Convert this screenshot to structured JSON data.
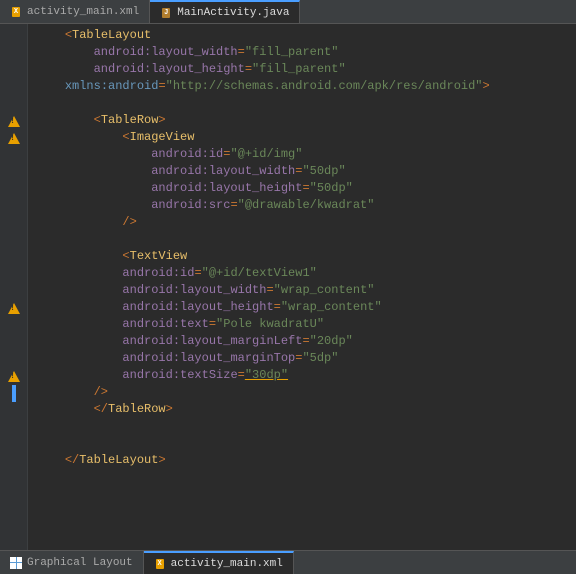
{
  "tabs": [
    {
      "id": "activity_main_xml",
      "label": "activity_main.xml",
      "type": "xml",
      "active": false
    },
    {
      "id": "mainactivity_java",
      "label": "MainActivity.java",
      "type": "java",
      "active": true
    }
  ],
  "code": {
    "lines": [
      {
        "indent": "    ",
        "content": [
          {
            "type": "punct",
            "text": "<"
          },
          {
            "type": "tag",
            "text": "TableLayout"
          }
        ]
      },
      {
        "indent": "        ",
        "content": [
          {
            "type": "attr",
            "text": "android:layout_width"
          },
          {
            "type": "punct",
            "text": "="
          },
          {
            "type": "val",
            "text": "\"fill_parent\""
          }
        ]
      },
      {
        "indent": "        ",
        "content": [
          {
            "type": "attr",
            "text": "android:layout_height"
          },
          {
            "type": "punct",
            "text": "="
          },
          {
            "type": "val",
            "text": "\"fill_parent\""
          }
        ]
      },
      {
        "indent": "    ",
        "content": [
          {
            "type": "ns",
            "text": "xmlns:android"
          },
          {
            "type": "punct",
            "text": "="
          },
          {
            "type": "val",
            "text": "\"http://schemas.android.com/apk/res/android\""
          },
          {
            "type": "punct",
            "text": ">"
          }
        ]
      },
      {
        "indent": "",
        "content": []
      },
      {
        "indent": "        ",
        "content": [
          {
            "type": "punct",
            "text": "<"
          },
          {
            "type": "tag",
            "text": "TableRow"
          },
          {
            "type": "punct",
            "text": ">"
          }
        ],
        "warn": true
      },
      {
        "indent": "            ",
        "content": [
          {
            "type": "punct",
            "text": "<"
          },
          {
            "type": "tag",
            "text": "ImageView"
          }
        ],
        "warn": true
      },
      {
        "indent": "                ",
        "content": [
          {
            "type": "attr",
            "text": "android:id"
          },
          {
            "type": "punct",
            "text": "="
          },
          {
            "type": "val",
            "text": "\"@+id/img\""
          }
        ]
      },
      {
        "indent": "                ",
        "content": [
          {
            "type": "attr",
            "text": "android:layout_width"
          },
          {
            "type": "punct",
            "text": "="
          },
          {
            "type": "val",
            "text": "\"50dp\""
          }
        ]
      },
      {
        "indent": "                ",
        "content": [
          {
            "type": "attr",
            "text": "android:layout_height"
          },
          {
            "type": "punct",
            "text": "="
          },
          {
            "type": "val",
            "text": "\"50dp\""
          }
        ]
      },
      {
        "indent": "                ",
        "content": [
          {
            "type": "attr",
            "text": "android:src"
          },
          {
            "type": "punct",
            "text": "="
          },
          {
            "type": "val",
            "text": "\"@drawable/kwadrat\""
          }
        ]
      },
      {
        "indent": "            ",
        "content": [
          {
            "type": "punct",
            "text": "/>"
          }
        ]
      },
      {
        "indent": "",
        "content": []
      },
      {
        "indent": "            ",
        "content": [
          {
            "type": "punct",
            "text": "<"
          },
          {
            "type": "tag",
            "text": "TextView"
          }
        ]
      },
      {
        "indent": "            ",
        "content": [
          {
            "type": "attr",
            "text": "android:id"
          },
          {
            "type": "punct",
            "text": "="
          },
          {
            "type": "val",
            "text": "\"@+id/textView1\""
          }
        ]
      },
      {
        "indent": "            ",
        "content": [
          {
            "type": "attr",
            "text": "android:layout_width"
          },
          {
            "type": "punct",
            "text": "="
          },
          {
            "type": "val",
            "text": "\"wrap_content\""
          }
        ]
      },
      {
        "indent": "            ",
        "content": [
          {
            "type": "attr",
            "text": "android:layout_height"
          },
          {
            "type": "punct",
            "text": "="
          },
          {
            "type": "val",
            "text": "\"wrap_content\""
          }
        ],
        "warn": true
      },
      {
        "indent": "            ",
        "content": [
          {
            "type": "attr",
            "text": "android:text"
          },
          {
            "type": "punct",
            "text": "="
          },
          {
            "type": "val",
            "text": "\"Pole kwadratU\""
          }
        ]
      },
      {
        "indent": "            ",
        "content": [
          {
            "type": "attr",
            "text": "android:layout_marginLeft"
          },
          {
            "type": "punct",
            "text": "="
          },
          {
            "type": "val",
            "text": "\"20dp\""
          }
        ]
      },
      {
        "indent": "            ",
        "content": [
          {
            "type": "attr",
            "text": "android:layout_marginTop"
          },
          {
            "type": "punct",
            "text": "="
          },
          {
            "type": "val",
            "text": "\"5dp\""
          }
        ]
      },
      {
        "indent": "            ",
        "content": [
          {
            "type": "attr",
            "text": "android:textSize"
          },
          {
            "type": "punct",
            "text": "="
          },
          {
            "type": "val",
            "text": "\"30dp\"",
            "underline": true
          }
        ],
        "warn": true
      },
      {
        "indent": "        ",
        "content": [
          {
            "type": "punct",
            "text": "/>"
          }
        ]
      },
      {
        "indent": "        ",
        "content": [
          {
            "type": "punct",
            "text": "</"
          },
          {
            "type": "tag",
            "text": "TableRow"
          },
          {
            "type": "punct",
            "text": ">"
          }
        ]
      },
      {
        "indent": "",
        "content": []
      },
      {
        "indent": "",
        "content": []
      },
      {
        "indent": "    ",
        "content": [
          {
            "type": "punct",
            "text": "</"
          },
          {
            "type": "tag",
            "text": "TableLayout"
          },
          {
            "type": "punct",
            "text": ">"
          }
        ]
      },
      {
        "indent": "",
        "content": []
      },
      {
        "indent": "",
        "content": []
      }
    ]
  },
  "bottom_tabs": [
    {
      "id": "graphical_layout",
      "label": "Graphical Layout",
      "type": "layout",
      "active": false
    },
    {
      "id": "activity_main_xml_tab",
      "label": "activity_main.xml",
      "type": "xml",
      "active": true
    }
  ],
  "warn_lines": [
    5,
    6,
    16,
    20
  ],
  "blue_bar_start": 22
}
